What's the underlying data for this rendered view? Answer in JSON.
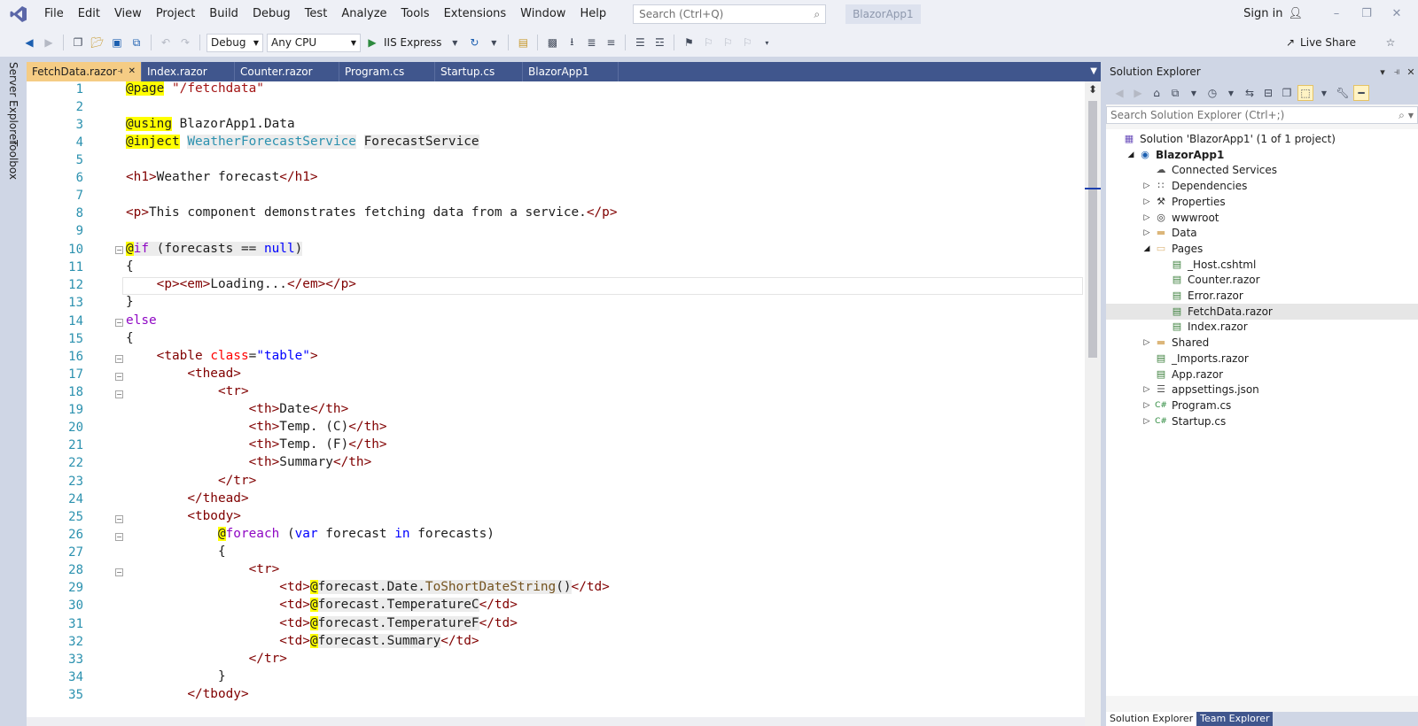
{
  "menu": [
    "File",
    "Edit",
    "View",
    "Project",
    "Build",
    "Debug",
    "Test",
    "Analyze",
    "Tools",
    "Extensions",
    "Window",
    "Help"
  ],
  "search": {
    "placeholder": "Search (Ctrl+Q)"
  },
  "app_title": "BlazorApp1",
  "sign_in": "Sign in",
  "toolbar": {
    "config": "Debug",
    "platform": "Any CPU",
    "run_target": "IIS Express",
    "live_share": "Live Share"
  },
  "side_strip": {
    "server_explorer": "Server Explorer",
    "toolbox": "Toolbox"
  },
  "doc_tabs": [
    {
      "label": "FetchData.razor",
      "active": true
    },
    {
      "label": "Index.razor"
    },
    {
      "label": "Counter.razor"
    },
    {
      "label": "Program.cs"
    },
    {
      "label": "Startup.cs"
    },
    {
      "label": "BlazorApp1"
    }
  ],
  "code_lines": [
    "1",
    "2",
    "3",
    "4",
    "5",
    "6",
    "7",
    "8",
    "9",
    "10",
    "11",
    "12",
    "13",
    "14",
    "15",
    "16",
    "17",
    "18",
    "19",
    "20",
    "21",
    "22",
    "23",
    "24",
    "25",
    "26",
    "27",
    "28",
    "29",
    "30",
    "31",
    "32",
    "33",
    "34",
    "35"
  ],
  "code": {
    "l1_dir": "@page",
    "l1_str": "\"/fetchdata\"",
    "l3_dir": "@using",
    "l3_rest": " BlazorApp1.Data",
    "l4_dir": "@inject",
    "l4_type": "WeatherForecastService",
    "l4_id": "ForecastService",
    "l6_open": "<h1>",
    "l6_text": "Weather forecast",
    "l6_close": "</h1>",
    "l8_open": "<p>",
    "l8_text": "This component demonstrates fetching data from a service.",
    "l8_close": "</p>",
    "l10_at": "@",
    "l10_if": "if",
    "l10_rest_a": " (forecasts == ",
    "l10_null": "null",
    "l10_rest_b": ")",
    "l11": "{",
    "l12_a": "<p><em>",
    "l12_text": "Loading...",
    "l12_b": "</em></p>",
    "l13": "}",
    "l14": "else",
    "l15": "{",
    "l16_a": "<table ",
    "l16_attr": "class",
    "l16_eq": "=",
    "l16_val": "\"table\"",
    "l16_b": ">",
    "l17": "<thead>",
    "l18": "<tr>",
    "l19_a": "<th>",
    "l19_t": "Date",
    "l19_b": "</th>",
    "l20_a": "<th>",
    "l20_t": "Temp. (C)",
    "l20_b": "</th>",
    "l21_a": "<th>",
    "l21_t": "Temp. (F)",
    "l21_b": "</th>",
    "l22_a": "<th>",
    "l22_t": "Summary",
    "l22_b": "</th>",
    "l23": "</tr>",
    "l24": "</thead>",
    "l25": "<tbody>",
    "l26_at": "@",
    "l26_kw": "foreach",
    "l26_a": " (",
    "l26_var": "var",
    "l26_b": " forecast ",
    "l26_in": "in",
    "l26_c": " forecasts)",
    "l27": "{",
    "l28": "<tr>",
    "l29_a": "<td>",
    "l29_at": "@",
    "l29_obj": "forecast",
    "l29_p": ".Date.",
    "l29_m": "ToShortDateString",
    "l29_par": "()",
    "l29_b": "</td>",
    "l30_a": "<td>",
    "l30_at": "@",
    "l30_obj": "forecast",
    "l30_p": ".TemperatureC",
    "l30_b": "</td>",
    "l31_a": "<td>",
    "l31_at": "@",
    "l31_obj": "forecast",
    "l31_p": ".TemperatureF",
    "l31_b": "</td>",
    "l32_a": "<td>",
    "l32_at": "@",
    "l32_obj": "forecast",
    "l32_p": ".Summary",
    "l32_b": "</td>",
    "l33": "</tr>",
    "l34": "}",
    "l35": "</tbody>"
  },
  "solution_explorer": {
    "title": "Solution Explorer",
    "search_placeholder": "Search Solution Explorer (Ctrl+;)",
    "items": [
      {
        "label": "Solution 'BlazorApp1' (1 of 1 project)",
        "icon": "solution-icon"
      },
      {
        "label": "BlazorApp1",
        "icon": "project-icon",
        "bold": true,
        "expanded": true
      },
      {
        "label": "Connected Services",
        "icon": "connected-services-icon"
      },
      {
        "label": "Dependencies",
        "icon": "dependencies-icon"
      },
      {
        "label": "Properties",
        "icon": "wrench-icon"
      },
      {
        "label": "wwwroot",
        "icon": "globe-icon"
      },
      {
        "label": "Data",
        "icon": "folder-icon"
      },
      {
        "label": "Pages",
        "icon": "folder-open-icon",
        "expanded": true
      },
      {
        "label": "_Host.cshtml",
        "icon": "razor-file-icon"
      },
      {
        "label": "Counter.razor",
        "icon": "razor-file-icon"
      },
      {
        "label": "Error.razor",
        "icon": "razor-file-icon"
      },
      {
        "label": "FetchData.razor",
        "icon": "razor-file-icon",
        "selected": true
      },
      {
        "label": "Index.razor",
        "icon": "razor-file-icon"
      },
      {
        "label": "Shared",
        "icon": "folder-icon"
      },
      {
        "label": "_Imports.razor",
        "icon": "razor-file-icon"
      },
      {
        "label": "App.razor",
        "icon": "razor-file-icon"
      },
      {
        "label": "appsettings.json",
        "icon": "json-file-icon"
      },
      {
        "label": "Program.cs",
        "icon": "csharp-file-icon"
      },
      {
        "label": "Startup.cs",
        "icon": "csharp-file-icon"
      }
    ],
    "bottom_tabs": [
      "Solution Explorer",
      "Team Explorer"
    ]
  },
  "colors": {
    "chrome": "#eef0f6",
    "tab_bar": "#40568d",
    "active_tab": "#f5cc84",
    "razor_highlight": "#ffff00",
    "line_number": "#2b91af"
  }
}
